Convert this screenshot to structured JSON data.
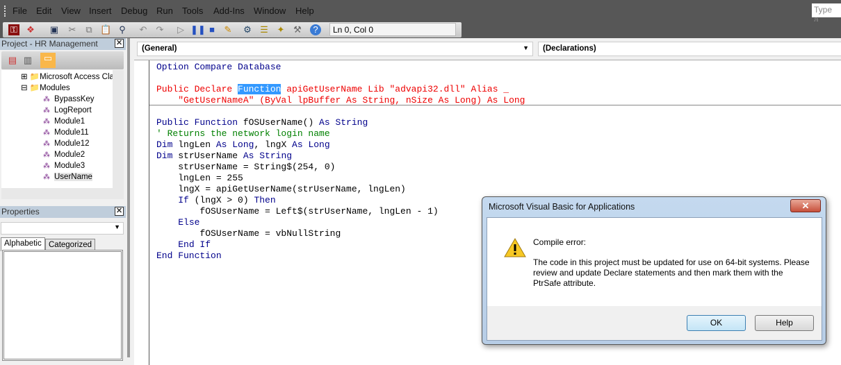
{
  "menubar": {
    "items": [
      "File",
      "Edit",
      "View",
      "Insert",
      "Debug",
      "Run",
      "Tools",
      "Add-Ins",
      "Window",
      "Help"
    ],
    "help_search_placeholder": "Type a"
  },
  "toolbar": {
    "position": "Ln 0, Col 0",
    "icons": [
      "access-icon",
      "insert-module-icon",
      "save-icon",
      "cut-icon",
      "copy-icon",
      "paste-icon",
      "find-icon",
      "undo-icon",
      "redo-icon",
      "run-icon",
      "break-icon",
      "reset-icon",
      "design-mode-icon",
      "project-explorer-icon",
      "properties-icon",
      "object-browser-icon",
      "toolbox-icon",
      "help-icon"
    ]
  },
  "project": {
    "title": "Project - HR Management",
    "tree": {
      "folders": [
        "Microsoft Access Cla",
        "Modules"
      ],
      "modules": [
        "BypassKey",
        "LogReport",
        "Module1",
        "Module11",
        "Module12",
        "Module2",
        "Module3",
        "UserName"
      ],
      "selected": "UserName"
    }
  },
  "properties": {
    "title": "Properties",
    "tabs": [
      "Alphabetic",
      "Categorized"
    ],
    "active_tab": "Alphabetic"
  },
  "code_window": {
    "object_combo": "(General)",
    "procedure_combo": "(Declarations)",
    "lines": [
      [
        [
          "Option Compare Database",
          "k"
        ]
      ],
      [],
      [
        [
          "Public Declare ",
          "r"
        ],
        [
          "Function",
          "s"
        ],
        [
          " apiGetUserName Lib \"advapi32.dll\" Alias _",
          "r"
        ]
      ],
      [
        [
          "    \"GetUserNameA\" (ByVal lpBuffer As String, nSize As Long) As Long",
          "r"
        ]
      ],
      [],
      [
        [
          "Public Function ",
          "k"
        ],
        [
          "fOSUserName() ",
          "n"
        ],
        [
          "As String",
          "k"
        ]
      ],
      [
        [
          "' Returns the network login name",
          "g"
        ]
      ],
      [
        [
          "Dim ",
          "k"
        ],
        [
          "lngLen ",
          "n"
        ],
        [
          "As Long",
          "k"
        ],
        [
          ", lngX ",
          "n"
        ],
        [
          "As Long",
          "k"
        ]
      ],
      [
        [
          "Dim ",
          "k"
        ],
        [
          "strUserName ",
          "n"
        ],
        [
          "As String",
          "k"
        ]
      ],
      [
        [
          "    strUserName = String$(254, 0)",
          "n"
        ]
      ],
      [
        [
          "    lngLen = 255",
          "n"
        ]
      ],
      [
        [
          "    lngX = apiGetUserName(strUserName, lngLen)",
          "n"
        ]
      ],
      [
        [
          "    ",
          "n"
        ],
        [
          "If ",
          "k"
        ],
        [
          "(lngX > 0) ",
          "n"
        ],
        [
          "Then",
          "k"
        ]
      ],
      [
        [
          "        fOSUserName = Left$(strUserName, lngLen - 1)",
          "n"
        ]
      ],
      [
        [
          "    ",
          "n"
        ],
        [
          "Else",
          "k"
        ]
      ],
      [
        [
          "        fOSUserName = vbNullString",
          "n"
        ]
      ],
      [
        [
          "    ",
          "n"
        ],
        [
          "End If",
          "k"
        ]
      ],
      [
        [
          "End Function",
          "k"
        ]
      ]
    ]
  },
  "dialog": {
    "title": "Microsoft Visual Basic for Applications",
    "heading": "Compile error:",
    "message": "The code in this project must be updated for use on 64-bit systems. Please review and update Declare statements and then mark them with the PtrSafe attribute.",
    "ok": "OK",
    "help": "Help",
    "icon": "warning-icon"
  },
  "colors": {
    "keyword": "#00008b",
    "error": "#ee0000",
    "comment": "#008000",
    "selection": "#3399ff"
  }
}
